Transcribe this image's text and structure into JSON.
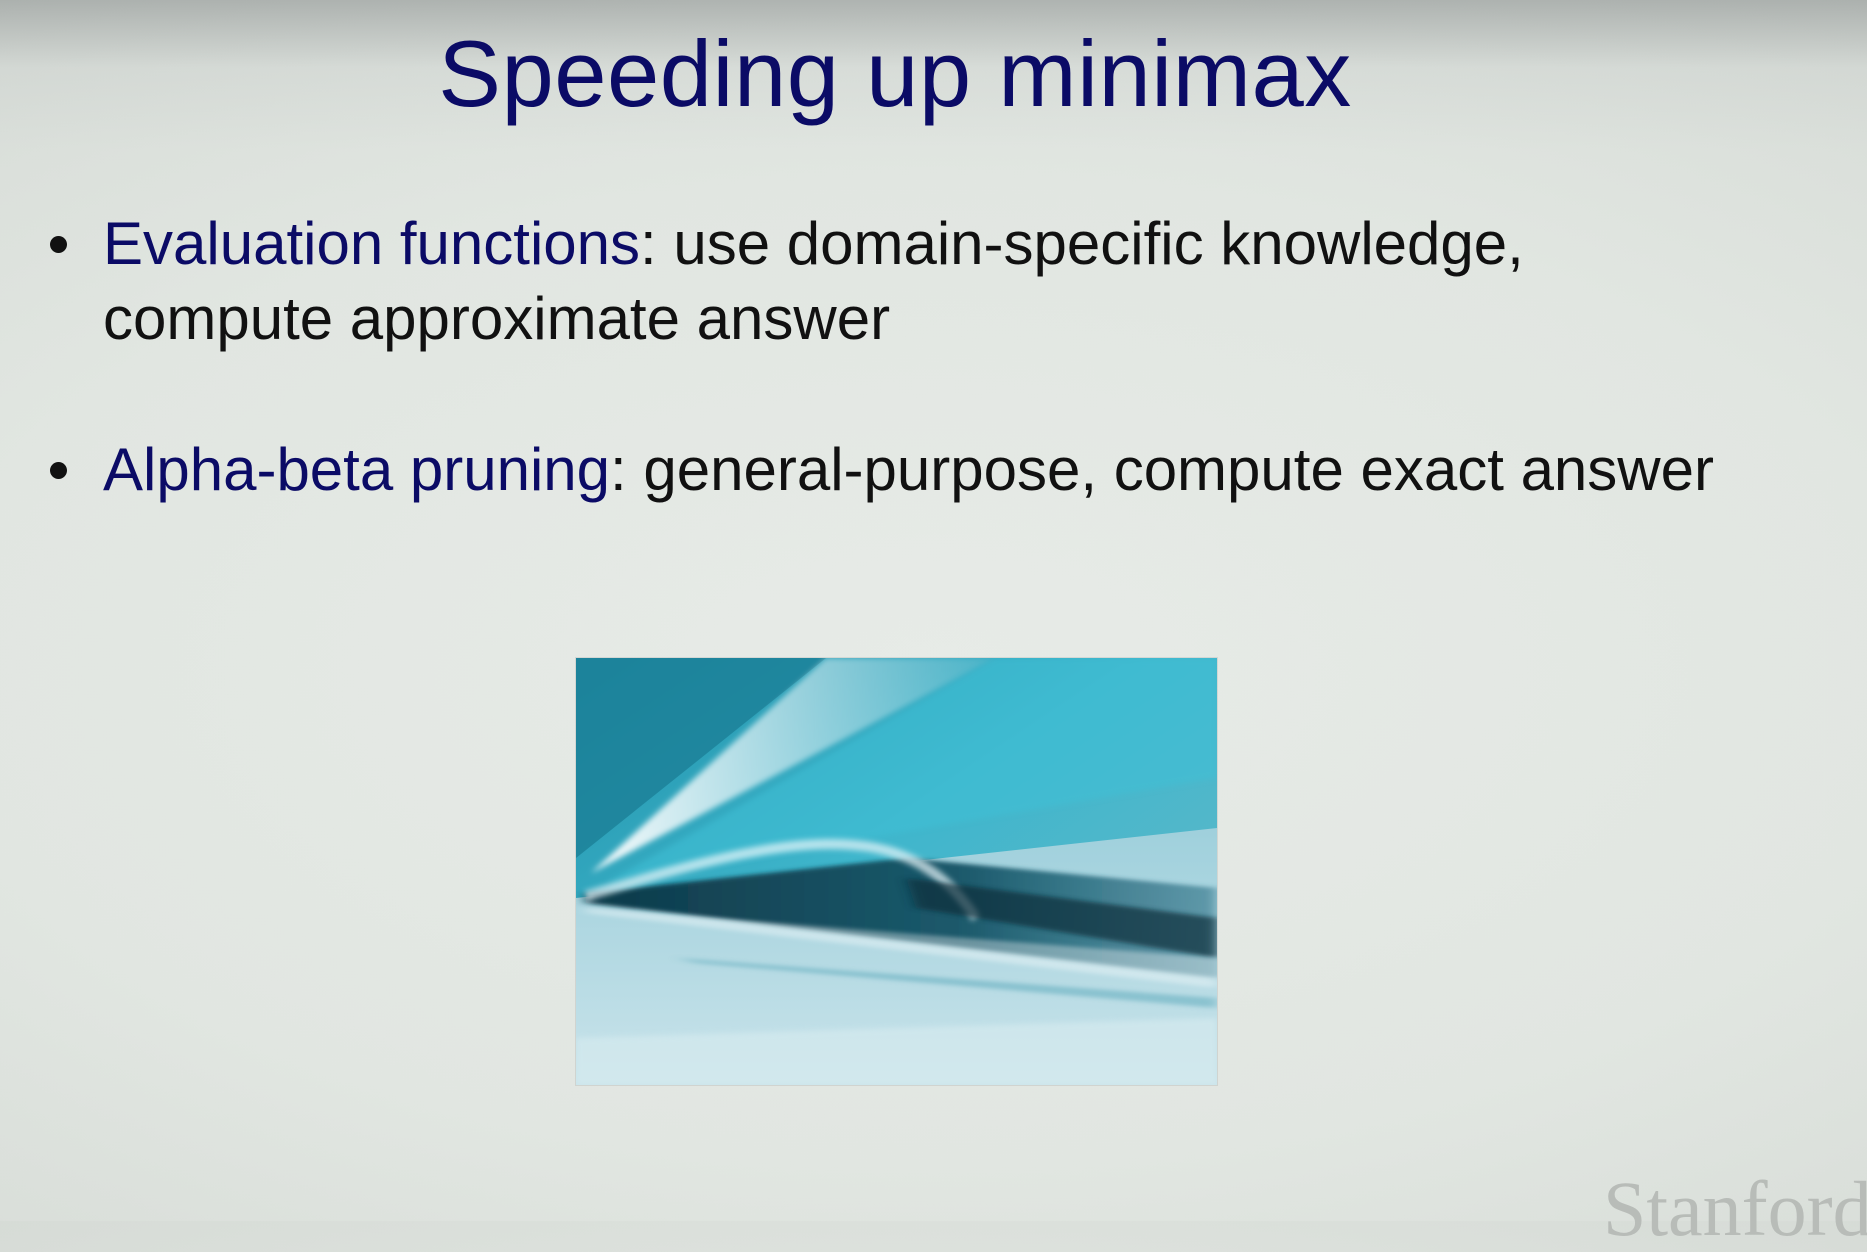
{
  "slide": {
    "title": "Speeding up minimax",
    "bullets": [
      {
        "term": "Evaluation functions",
        "text": ": use domain-specific knowledge, compute approximate answer"
      },
      {
        "term": "Alpha-beta pruning",
        "text": ": general-purpose, compute exact answer"
      }
    ],
    "image": {
      "description_icon": "train-photo-icon"
    },
    "logo": "Stanford"
  },
  "colors": {
    "title": "#0b0b66",
    "term": "#0b0b66",
    "body_text": "#111111",
    "background": "#e1e6e1"
  }
}
